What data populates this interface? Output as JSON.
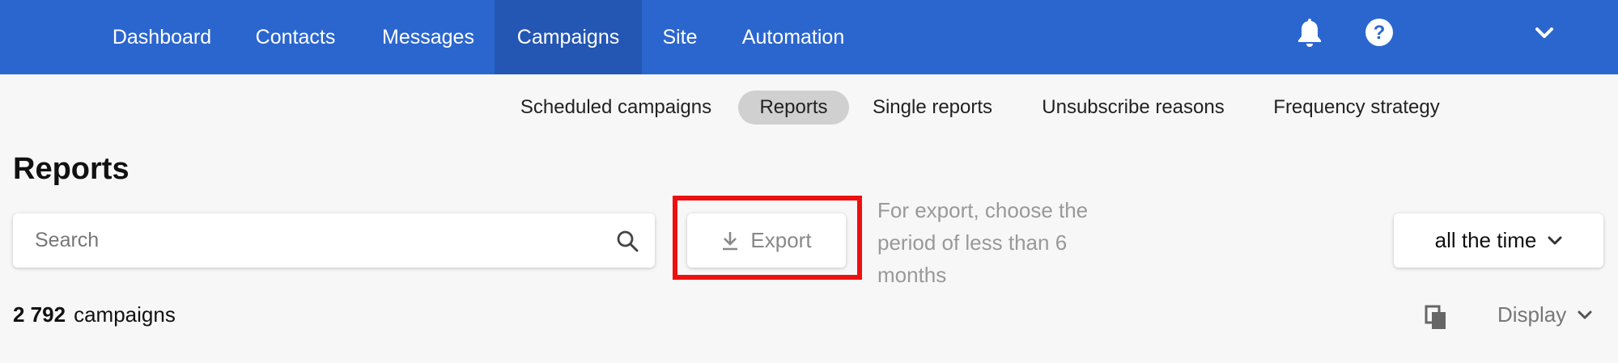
{
  "topnav": {
    "items": [
      {
        "label": "Dashboard"
      },
      {
        "label": "Contacts"
      },
      {
        "label": "Messages"
      },
      {
        "label": "Campaigns",
        "active": true
      },
      {
        "label": "Site"
      },
      {
        "label": "Automation"
      }
    ],
    "icons": [
      "bell-icon",
      "help-icon",
      "chevron-down-icon"
    ]
  },
  "subnav": {
    "items": [
      {
        "label": "Scheduled campaigns"
      },
      {
        "label": "Reports",
        "active": true
      },
      {
        "label": "Single reports"
      },
      {
        "label": "Unsubscribe reasons"
      },
      {
        "label": "Frequency strategy"
      }
    ]
  },
  "page": {
    "title": "Reports"
  },
  "search": {
    "placeholder": "Search",
    "value": ""
  },
  "export": {
    "label": "Export",
    "hint": "For export, choose the period of less than 6 months"
  },
  "period": {
    "value": "all the time"
  },
  "summary": {
    "count": "2 792",
    "unit": "campaigns"
  },
  "display": {
    "label": "Display"
  },
  "colors": {
    "nav_bg": "#2b66cf",
    "nav_active": "#2456b4",
    "highlight": "#ee1010",
    "subnav_active": "#d0d0d0"
  }
}
